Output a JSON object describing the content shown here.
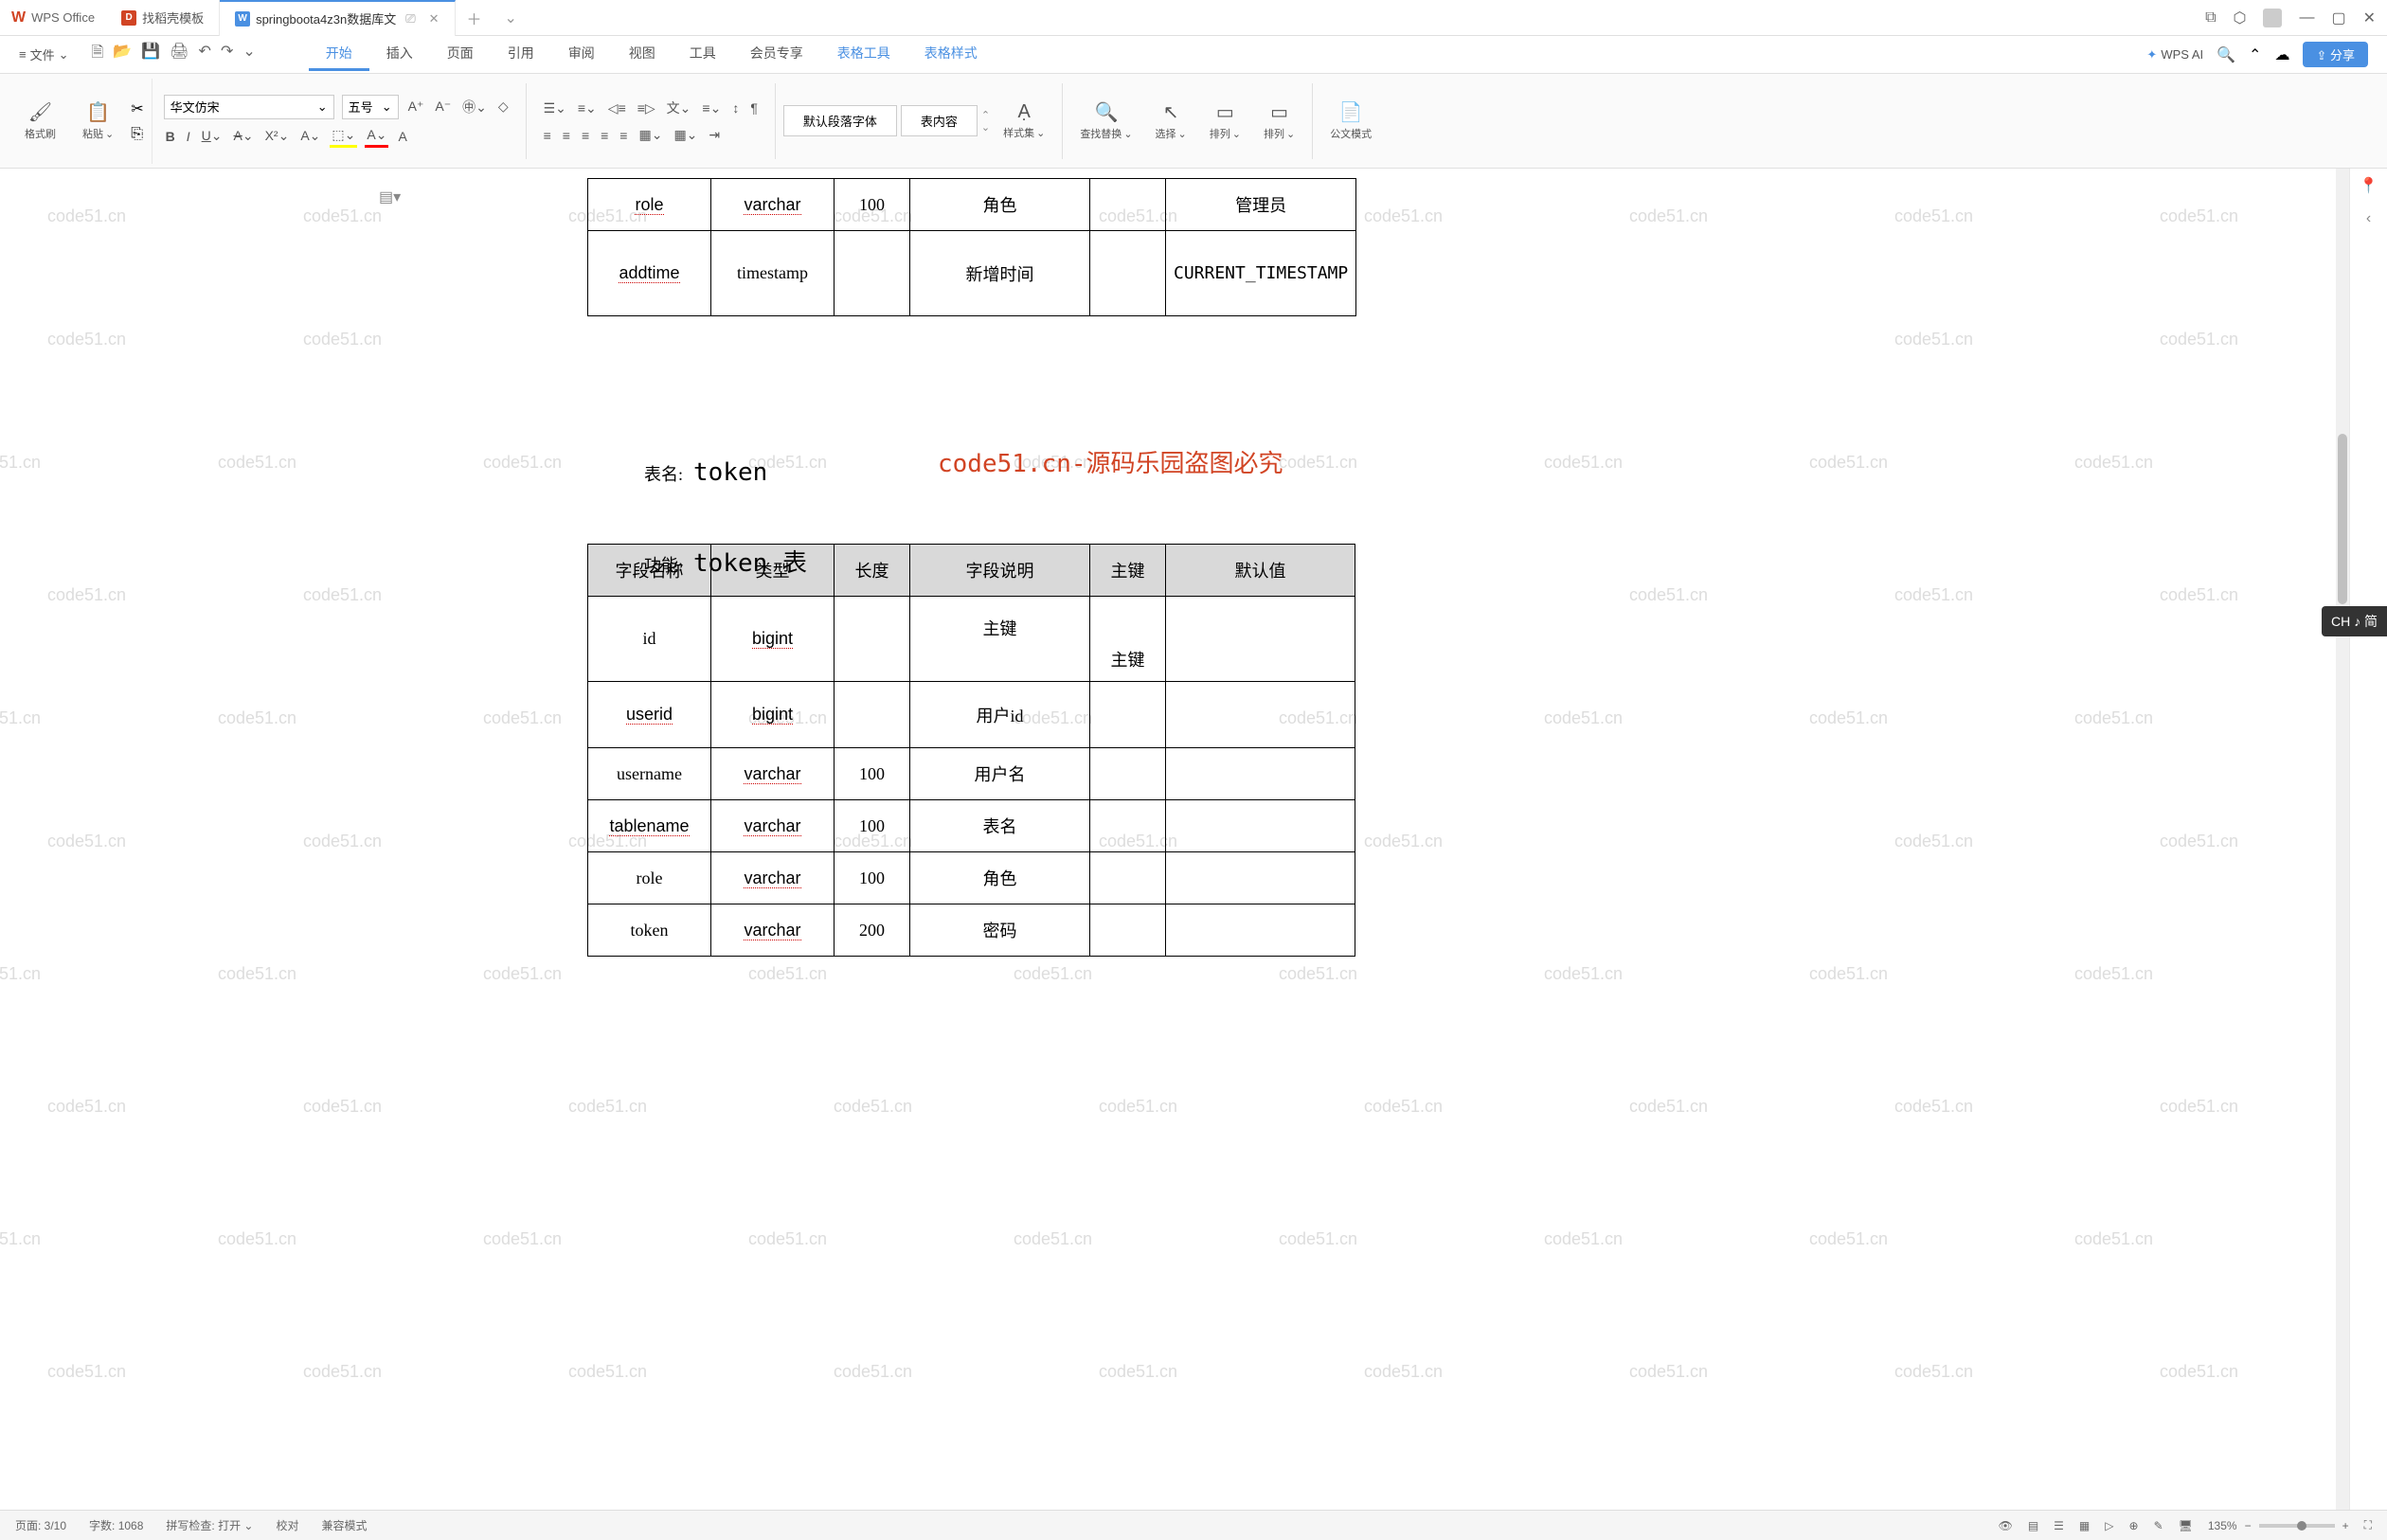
{
  "app": {
    "name": "WPS Office"
  },
  "tabs": [
    {
      "icon": "D",
      "label": "找稻壳模板",
      "active": false
    },
    {
      "icon": "W",
      "label": "springboota4z3n数据库文",
      "active": true
    }
  ],
  "title_icons": {
    "monitor": "⧉",
    "cube": "⬡",
    "avatar": "👤",
    "min": "—",
    "max": "▢",
    "close": "✕"
  },
  "file_menu": {
    "hamburger": "≡",
    "label": "文件"
  },
  "qat": {
    "new": "🗎",
    "open": "📂",
    "save": "💾",
    "print": "🖨",
    "undo": "↶",
    "redo": "↷"
  },
  "menu": {
    "start": "开始",
    "insert": "插入",
    "page": "页面",
    "ref": "引用",
    "review": "审阅",
    "view": "视图",
    "tools": "工具",
    "member": "会员专享",
    "table_tools": "表格工具",
    "table_style": "表格样式"
  },
  "menu_right": {
    "wps_ai": "WPS AI",
    "search": "🔍",
    "cloud": "☁",
    "share": "分享"
  },
  "ribbon": {
    "format_painter": "格式刷",
    "paste": "粘贴",
    "cut": "✂",
    "font_name": "华文仿宋",
    "font_size": "五号",
    "style_para": "默认段落字体",
    "style_content": "表内容",
    "style_set": "样式集",
    "find": "查找替换",
    "select": "选择",
    "sort1": "排列",
    "sort2": "排列",
    "formula": "公文模式"
  },
  "document": {
    "toc_icon": "▤▾",
    "table1": {
      "rows": [
        {
          "name": "role",
          "type": "varchar",
          "len": "100",
          "desc": "角色",
          "pk": "",
          "def": "管理员"
        },
        {
          "name": "addtime",
          "type": "timestamp",
          "len": "",
          "desc": "新增时间",
          "pk": "",
          "def": "CURRENT_TIMESTAMP"
        }
      ]
    },
    "section2": {
      "table_name_label": "表名:",
      "table_name_value": "token",
      "func_label": "功能:",
      "func_value": "token 表",
      "red_watermark": "code51.cn-源码乐园盗图必究"
    },
    "table2": {
      "headers": {
        "name": "字段名称",
        "type": "类型",
        "len": "长度",
        "desc": "字段说明",
        "pk": "主键",
        "def": "默认值"
      },
      "rows": [
        {
          "name": "id",
          "type": "bigint",
          "len": "",
          "desc": "主键",
          "pk": "主键",
          "def": ""
        },
        {
          "name": "userid",
          "type": "bigint",
          "len": "",
          "desc": "用户id",
          "pk": "",
          "def": ""
        },
        {
          "name": "username",
          "type": "varchar",
          "len": "100",
          "desc": "用户名",
          "pk": "",
          "def": ""
        },
        {
          "name": "tablename",
          "type": "varchar",
          "len": "100",
          "desc": "表名",
          "pk": "",
          "def": ""
        },
        {
          "name": "role",
          "type": "varchar",
          "len": "100",
          "desc": "角色",
          "pk": "",
          "def": ""
        },
        {
          "name": "token",
          "type": "varchar",
          "len": "200",
          "desc": "密码",
          "pk": "",
          "def": ""
        }
      ]
    },
    "watermark_text": "code51.cn"
  },
  "ime": {
    "label": "CH ♪ 简"
  },
  "status": {
    "page": "页面: 3/10",
    "words": "字数: 1068",
    "spell": "拼写检查: 打开",
    "proof": "校对",
    "compat": "兼容模式",
    "zoom": "135%"
  }
}
